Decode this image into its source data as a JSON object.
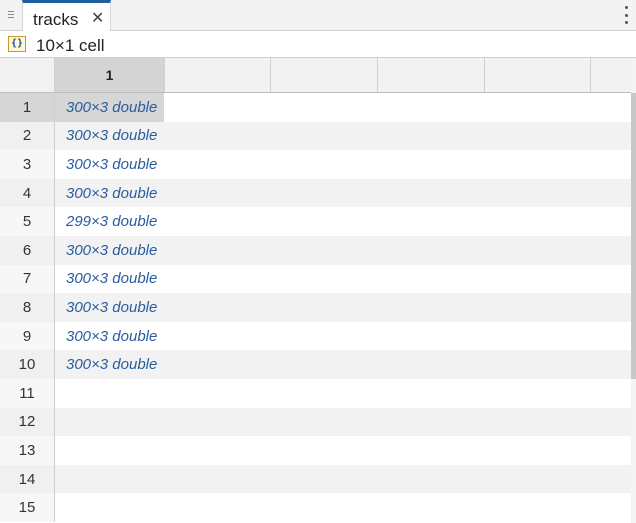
{
  "tab": {
    "grip_icon": "drag-handle-icon",
    "title": "tracks",
    "close_glyph": "✕",
    "menu_icon": "kebab-menu-icon"
  },
  "info": {
    "type_icon": "cell-array-icon",
    "type_glyph": "{}",
    "dimensions": "10×1 cell"
  },
  "grid": {
    "column_headers": [
      "1",
      "",
      "",
      "",
      "",
      ""
    ],
    "selected_column": "1",
    "rows": [
      {
        "index": "1",
        "value": "300×3 double"
      },
      {
        "index": "2",
        "value": "300×3 double"
      },
      {
        "index": "3",
        "value": "300×3 double"
      },
      {
        "index": "4",
        "value": "300×3 double"
      },
      {
        "index": "5",
        "value": "299×3 double"
      },
      {
        "index": "6",
        "value": "300×3 double"
      },
      {
        "index": "7",
        "value": "300×3 double"
      },
      {
        "index": "8",
        "value": "300×3 double"
      },
      {
        "index": "9",
        "value": "300×3 double"
      },
      {
        "index": "10",
        "value": "300×3 double"
      },
      {
        "index": "11",
        "value": ""
      },
      {
        "index": "12",
        "value": ""
      },
      {
        "index": "13",
        "value": ""
      },
      {
        "index": "14",
        "value": ""
      },
      {
        "index": "15",
        "value": ""
      }
    ],
    "selected_row": "1",
    "colors": {
      "value_text": "#2a5d9e",
      "selection": "#d6d6d6",
      "tab_accent": "#1f5f9f"
    }
  }
}
